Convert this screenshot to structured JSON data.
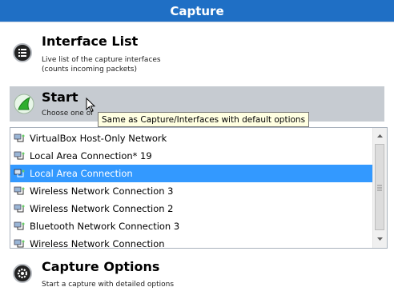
{
  "header": {
    "title": "Capture"
  },
  "interface_list": {
    "title": "Interface List",
    "description_line1": "Live list of the capture interfaces",
    "description_line2": "(counts incoming packets)",
    "icon": "list-icon"
  },
  "start": {
    "title": "Start",
    "description": "Choose one of",
    "icon": "shark-fin-icon",
    "accent": "#2fae2f"
  },
  "tooltip": {
    "text": "Same as Capture/Interfaces with default options"
  },
  "interfaces": [
    {
      "label": "VirtualBox Host-Only Network",
      "selected": false
    },
    {
      "label": "Local Area Connection* 19",
      "selected": false
    },
    {
      "label": "Local Area Connection",
      "selected": true
    },
    {
      "label": "Wireless Network Connection 3",
      "selected": false
    },
    {
      "label": "Wireless Network Connection 2",
      "selected": false
    },
    {
      "label": "Bluetooth Network Connection 3",
      "selected": false
    },
    {
      "label": "Wireless Network Connection",
      "selected": false
    }
  ],
  "capture_options": {
    "title": "Capture Options",
    "description": "Start a capture with detailed options",
    "icon": "gear-icon"
  },
  "colors": {
    "header_bg": "#1f6fc5",
    "selection_bg": "#3399ff",
    "start_bar_bg": "#c6cbd1"
  }
}
